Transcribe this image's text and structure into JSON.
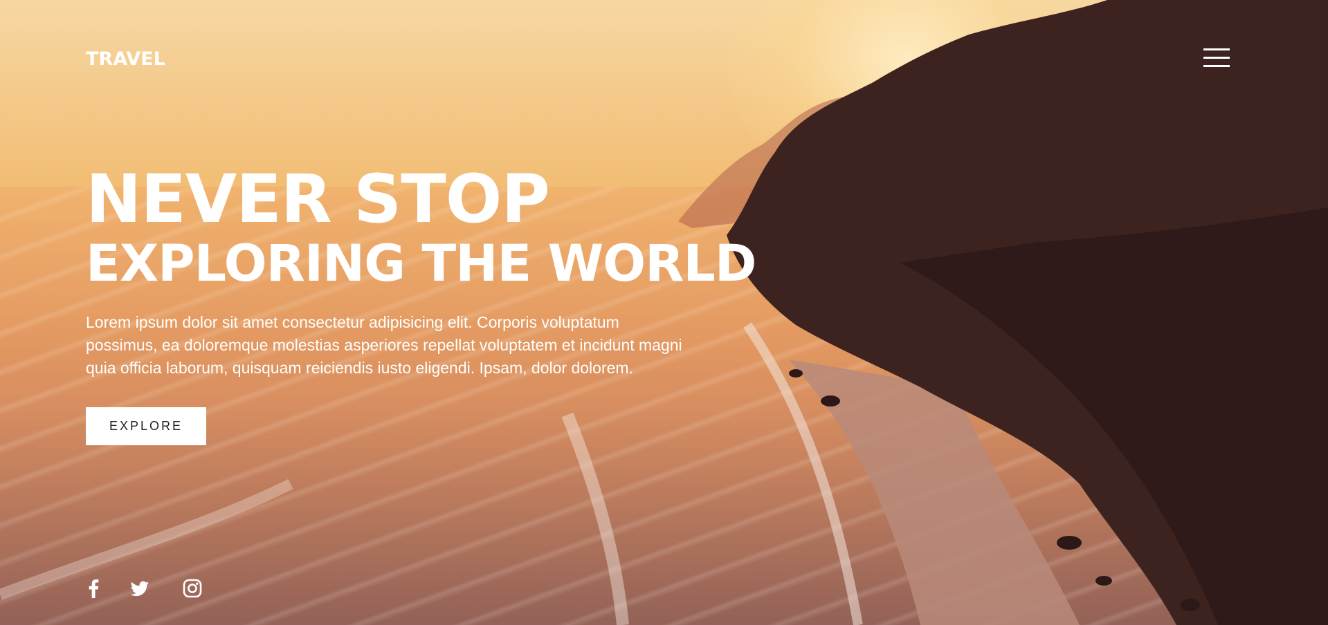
{
  "nav": {
    "logo": "TRAVEL",
    "menu_icon": "hamburger-menu-icon"
  },
  "hero": {
    "headline_line1": "NEVER STOP",
    "headline_line2": "EXPLORING THE WORLD",
    "body": "Lorem ipsum dolor sit amet consectetur adipisicing elit. Corporis voluptatum possimus, ea doloremque molestias asperiores repellat voluptatem et incidunt magni quia officia laborum, quisquam reiciendis iusto eligendi. Ipsam, dolor dolorem.",
    "cta_label": "EXPLORE"
  },
  "social": {
    "icons": [
      "facebook-icon",
      "twitter-icon",
      "instagram-icon"
    ]
  },
  "colors": {
    "text": "#ffffff",
    "button_bg": "#ffffff",
    "button_text": "#222222"
  }
}
